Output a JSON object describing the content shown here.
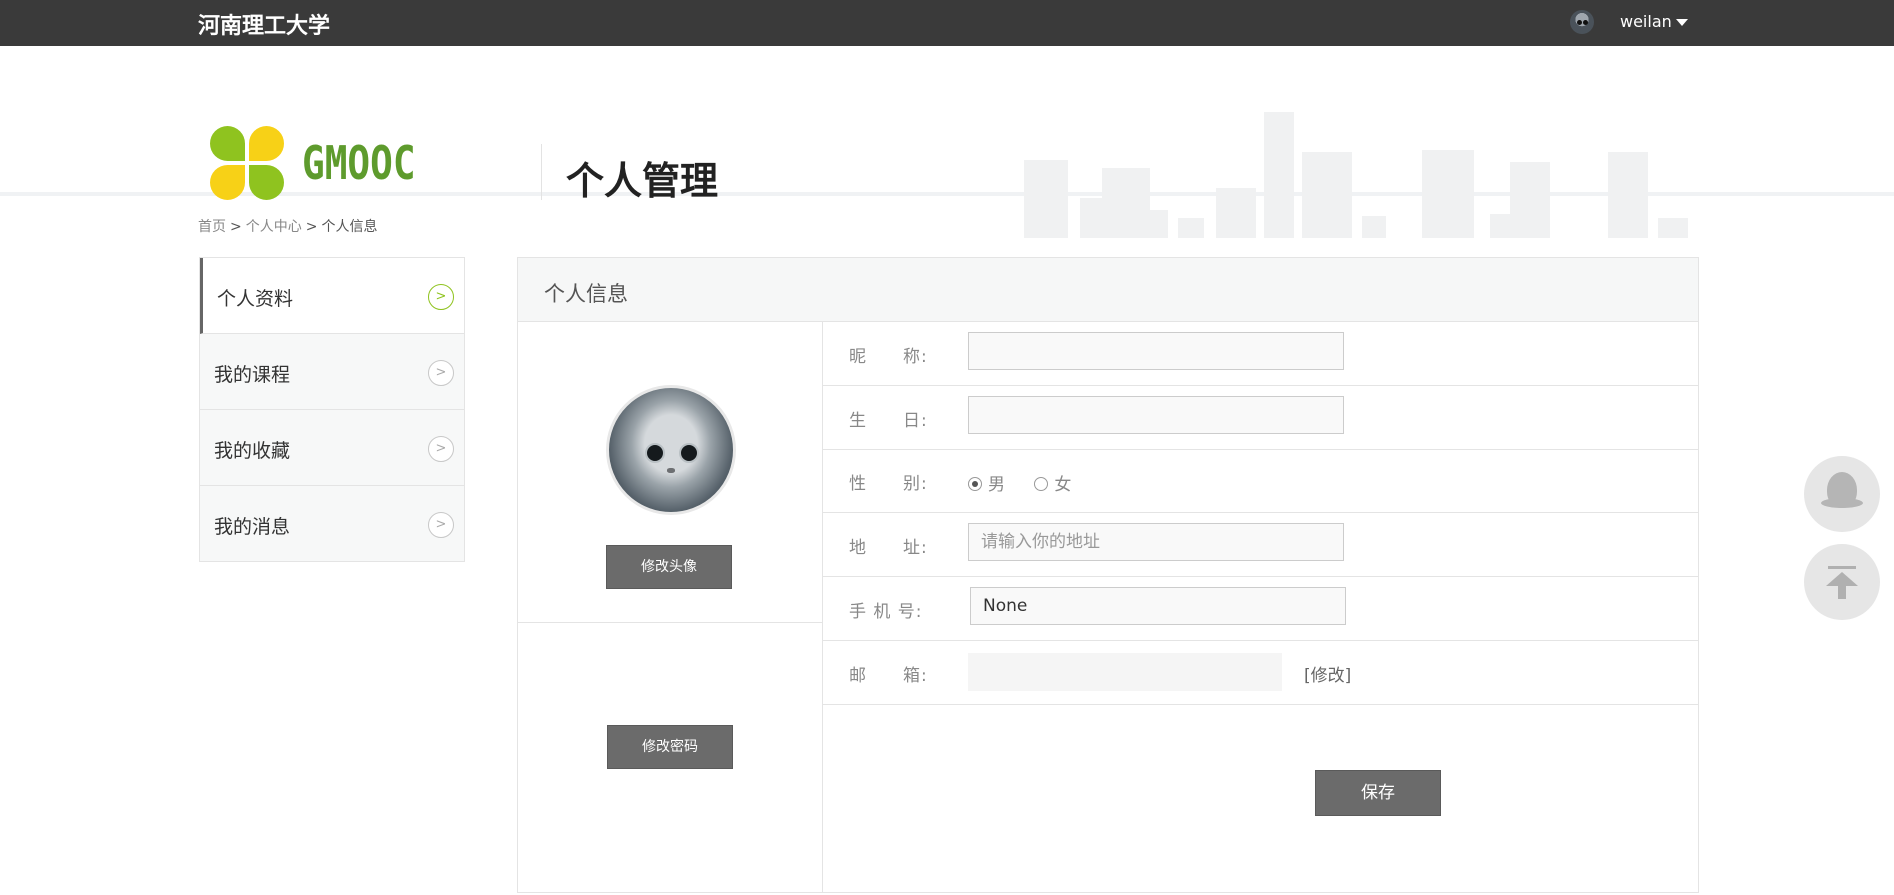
{
  "topbar": {
    "school": "河南理工大学",
    "username": "weilan"
  },
  "header": {
    "brand": "GMOOC",
    "section_title": "个人管理"
  },
  "breadcrumb": {
    "home": "首页",
    "center": "个人中心",
    "current": "个人信息",
    "separator": ">"
  },
  "sidebar": {
    "items": [
      {
        "label": "个人资料",
        "active": true
      },
      {
        "label": "我的课程",
        "active": false
      },
      {
        "label": "我的收藏",
        "active": false
      },
      {
        "label": "我的消息",
        "active": false
      }
    ]
  },
  "panel": {
    "title": "个人信息",
    "change_avatar": "修改头像",
    "change_password": "修改密码",
    "fields": {
      "nickname": {
        "label": "昵　　称:",
        "value": ""
      },
      "birthday": {
        "label": "生　　日:",
        "value": ""
      },
      "gender": {
        "label": "性　　别:",
        "options": [
          "男",
          "女"
        ],
        "selected": "男"
      },
      "address": {
        "label": "地　　址:",
        "value": "",
        "placeholder": "请输入你的地址"
      },
      "mobile": {
        "label": "手 机 号:",
        "value": "None"
      },
      "email": {
        "label": "邮　　箱:",
        "value": "",
        "edit": "[修改]"
      }
    },
    "save": "保存"
  },
  "colors": {
    "topbar": "#3a3a3a",
    "brand_green": "#5e9b2d",
    "accent_green": "#8fc31f",
    "logo_yellow": "#f7d117",
    "button_gray": "#6b6b6b"
  },
  "icons": {
    "qq": "qq-icon",
    "back_to_top": "back-to-top-icon",
    "arrow": "chevron-right-icon"
  }
}
